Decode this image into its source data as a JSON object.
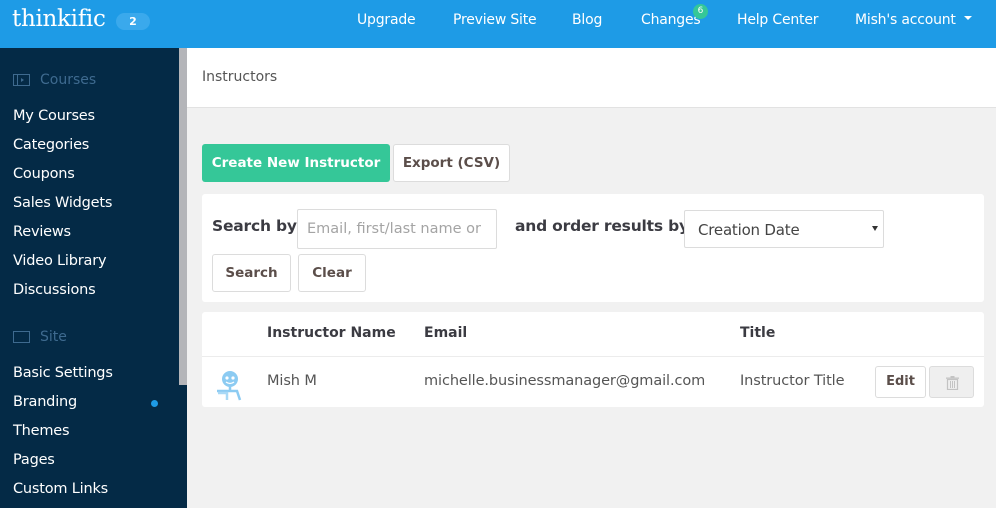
{
  "topbar": {
    "logo": "thinkific",
    "logo_badge": "2",
    "nav": [
      {
        "label": "Upgrade"
      },
      {
        "label": "Preview Site"
      },
      {
        "label": "Blog"
      },
      {
        "label": "Changes",
        "badge": "6"
      },
      {
        "label": "Help Center"
      },
      {
        "label": "Mish's account"
      }
    ]
  },
  "sidebar": {
    "sections": [
      {
        "title": "Courses",
        "icon": "video-icon",
        "items": [
          {
            "label": "My Courses"
          },
          {
            "label": "Categories"
          },
          {
            "label": "Coupons"
          },
          {
            "label": "Sales Widgets"
          },
          {
            "label": "Reviews"
          },
          {
            "label": "Video Library"
          },
          {
            "label": "Discussions"
          }
        ]
      },
      {
        "title": "Site",
        "icon": "browser-window-icon",
        "items": [
          {
            "label": "Basic Settings"
          },
          {
            "label": "Branding",
            "indicator": true
          },
          {
            "label": "Themes"
          },
          {
            "label": "Pages"
          },
          {
            "label": "Custom Links"
          }
        ]
      }
    ]
  },
  "page": {
    "title": "Instructors"
  },
  "actions": {
    "create_label": "Create New Instructor",
    "export_label": "Export (CSV)"
  },
  "search": {
    "search_by_label": "Search by",
    "input_placeholder": "Email, first/last name or",
    "input_value": "",
    "order_label": "and order results by",
    "order_selected": "Creation Date",
    "search_button": "Search",
    "clear_button": "Clear"
  },
  "table": {
    "columns": [
      "Instructor Name",
      "Email",
      "Title"
    ],
    "rows": [
      {
        "name": "Mish M",
        "email": "michelle.businessmanager@gmail.com",
        "title": "Instructor Title",
        "edit_label": "Edit"
      }
    ]
  },
  "colors": {
    "topbar": "#1e9be6",
    "sidebar": "#042a46",
    "primary_green": "#35c798",
    "badge_green": "#35c798"
  }
}
